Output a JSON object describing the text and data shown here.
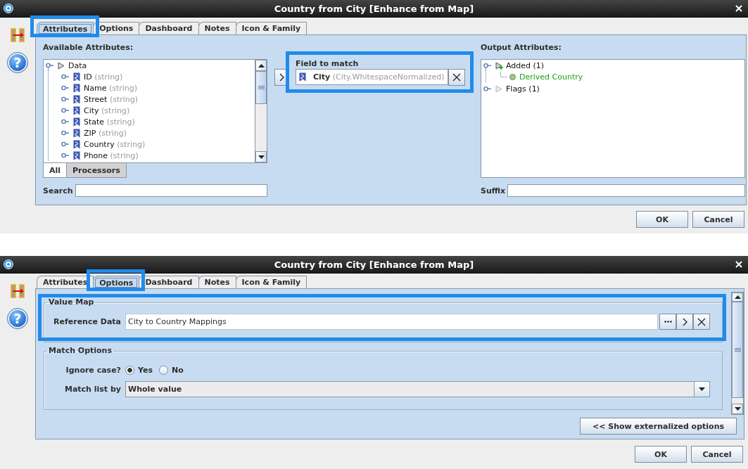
{
  "dialogs": [
    {
      "kind": "attributes",
      "title": "Country from City [Enhance from Map]",
      "help": "?",
      "tabs": [
        {
          "label": "Attributes",
          "selected": true,
          "highlighted": true
        },
        {
          "label": "Options",
          "selected": false,
          "highlighted": false
        },
        {
          "label": "Dashboard",
          "selected": false,
          "highlighted": false
        },
        {
          "label": "Notes",
          "selected": false,
          "highlighted": false
        },
        {
          "label": "Icon & Family",
          "selected": false,
          "highlighted": false
        }
      ],
      "available_attributes": {
        "heading": "Available Attributes:",
        "tree": [
          {
            "kind": "group",
            "label": "Data",
            "expanded": true,
            "children": [
              {
                "kind": "attribute",
                "label": "ID",
                "type": "(string)",
                "expanded": false
              },
              {
                "kind": "attribute",
                "label": "Name",
                "type": "(string)",
                "expanded": false
              },
              {
                "kind": "attribute",
                "label": "Street",
                "type": "(string)",
                "expanded": false
              },
              {
                "kind": "attribute",
                "label": "City",
                "type": "(string)",
                "expanded": false
              },
              {
                "kind": "attribute",
                "label": "State",
                "type": "(string)",
                "expanded": false
              },
              {
                "kind": "attribute",
                "label": "ZIP",
                "type": "(string)",
                "expanded": false
              },
              {
                "kind": "attribute",
                "label": "Country",
                "type": "(string)",
                "expanded": false
              },
              {
                "kind": "attribute",
                "label": "Phone",
                "type": "(string)",
                "expanded": false
              }
            ]
          }
        ],
        "view_tabs": [
          {
            "label": "All",
            "selected": true
          },
          {
            "label": "Processors",
            "selected": false
          }
        ],
        "search": {
          "label": "Search"
        }
      },
      "field_to_match": {
        "heading": "Field to match",
        "highlighted": true,
        "name": "City",
        "detail": "(City.WhitespaceNormalized)"
      },
      "output_attributes": {
        "heading": "Output Attributes:",
        "tree": [
          {
            "kind": "added",
            "label": "Added (1)",
            "expanded": true,
            "children": [
              {
                "kind": "derived",
                "label": "Derived Country"
              }
            ]
          },
          {
            "kind": "flags",
            "label": "Flags (1)",
            "expanded": false
          }
        ],
        "suffix": {
          "label": "Suffix"
        }
      },
      "buttons": [
        "OK",
        "Cancel"
      ]
    },
    {
      "kind": "options",
      "title": "Country from City [Enhance from Map]",
      "help": "?",
      "tabs": [
        {
          "label": "Attributes",
          "selected": false,
          "highlighted": false
        },
        {
          "label": "Options",
          "selected": true,
          "highlighted": true
        },
        {
          "label": "Dashboard",
          "selected": false,
          "highlighted": false
        },
        {
          "label": "Notes",
          "selected": false,
          "highlighted": false
        },
        {
          "label": "Icon & Family",
          "selected": false,
          "highlighted": false
        }
      ],
      "value_map": {
        "legend": "Value Map",
        "highlighted": true,
        "reference_data": {
          "label": "Reference Data",
          "value": "City to Country Mappings"
        }
      },
      "match_options": {
        "legend": "Match Options",
        "ignore_case": {
          "label": "Ignore case?",
          "options": [
            {
              "label": "Yes",
              "selected": true
            },
            {
              "label": "No",
              "selected": false
            }
          ]
        },
        "match_list_by": {
          "label": "Match list by",
          "value": "Whole value"
        }
      },
      "externalize_button": "<< Show externalized options",
      "buttons": [
        "OK",
        "Cancel"
      ]
    }
  ]
}
